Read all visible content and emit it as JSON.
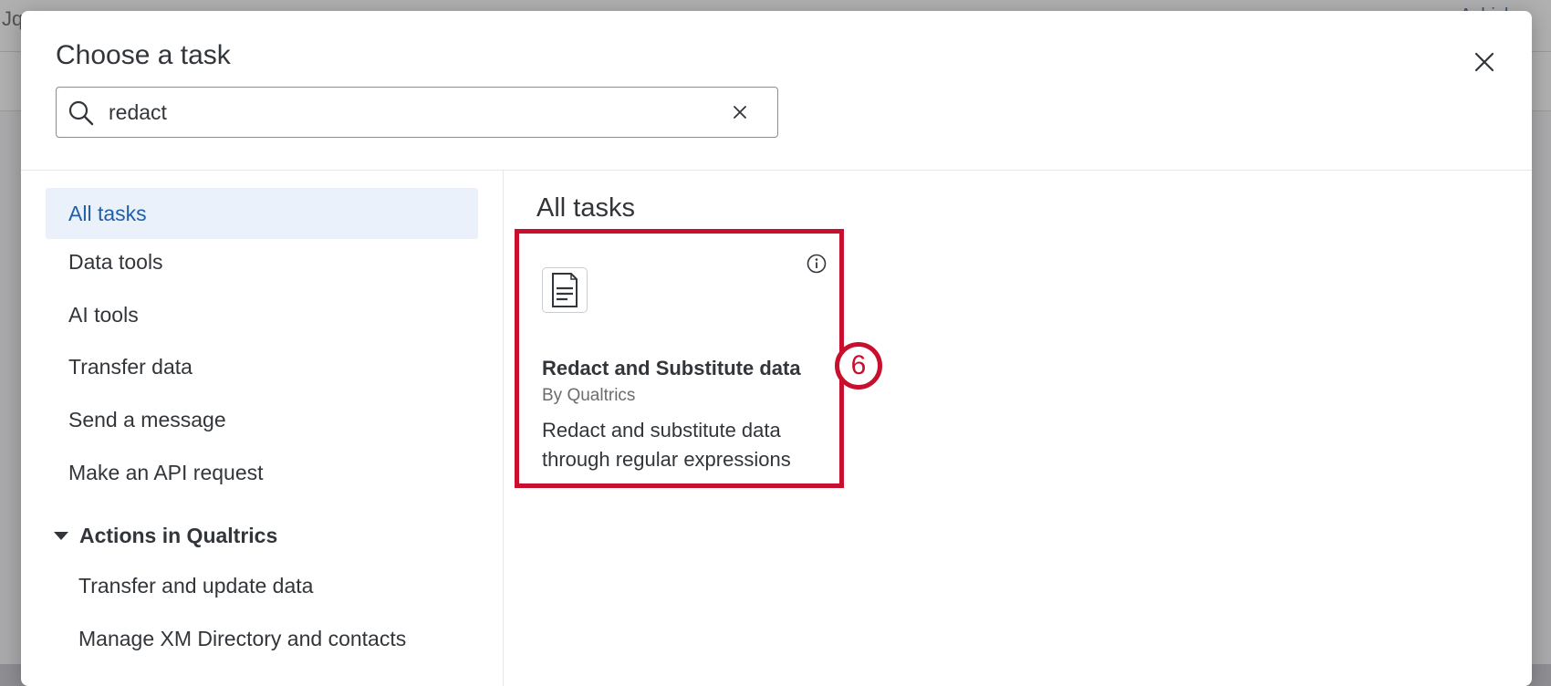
{
  "background": {
    "title_fragment": "Jqr",
    "user_fragment": "Ashish"
  },
  "modal": {
    "title": "Choose a task",
    "close_icon": "close-icon"
  },
  "search": {
    "value": "redact",
    "placeholder": "",
    "icon": "search-icon",
    "clear_icon": "clear-icon"
  },
  "sidebar": {
    "items": [
      {
        "label": "All tasks",
        "active": true
      },
      {
        "label": "Data tools",
        "active": false
      },
      {
        "label": "AI tools",
        "active": false
      },
      {
        "label": "Transfer data",
        "active": false
      },
      {
        "label": "Send a message",
        "active": false
      },
      {
        "label": "Make an API request",
        "active": false
      }
    ],
    "group": {
      "label": "Actions in Qualtrics",
      "expanded": true,
      "items": [
        {
          "label": "Transfer and update data"
        },
        {
          "label": "Manage XM Directory and contacts"
        }
      ]
    }
  },
  "main": {
    "heading": "All tasks",
    "tasks": [
      {
        "title": "Redact and Substitute data",
        "author": "By Qualtrics",
        "description": "Redact and substitute data through regular expressions",
        "icon": "document-icon",
        "info_icon": "info-icon"
      }
    ]
  },
  "annotation": {
    "step_number": "6",
    "highlight_color": "#c8102e"
  },
  "colors": {
    "active_bg": "#eaf1fb",
    "active_text": "#1f5fa8",
    "text": "#32363a"
  }
}
